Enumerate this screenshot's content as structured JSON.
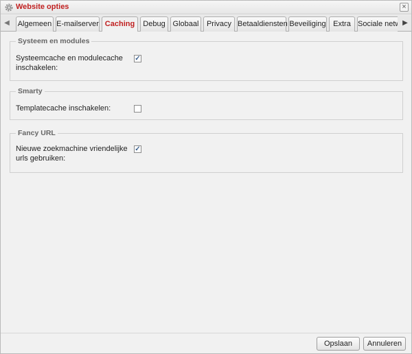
{
  "window": {
    "title": "Website opties",
    "close_label": "×"
  },
  "tabs": [
    {
      "label": "Algemeen"
    },
    {
      "label": "E-mailserver"
    },
    {
      "label": "Caching",
      "active": true
    },
    {
      "label": "Debug"
    },
    {
      "label": "Globaal"
    },
    {
      "label": "Privacy"
    },
    {
      "label": "Betaaldiensten"
    },
    {
      "label": "Beveiliging"
    },
    {
      "label": "Extra"
    },
    {
      "label": "Sociale netwe"
    }
  ],
  "scroll": {
    "left": "◀",
    "right": "▶"
  },
  "sections": {
    "systeem": {
      "legend": "Systeem en modules",
      "label": "Systeemcache en modulecache inschakelen:",
      "checked": true
    },
    "smarty": {
      "legend": "Smarty",
      "label": "Templatecache inschakelen:",
      "checked": false
    },
    "fancy": {
      "legend": "Fancy URL",
      "label": "Nieuwe zoekmachine vriendelijke urls gebruiken:",
      "checked": true
    }
  },
  "footer": {
    "save_label": "Opslaan",
    "cancel_label": "Annuleren"
  }
}
